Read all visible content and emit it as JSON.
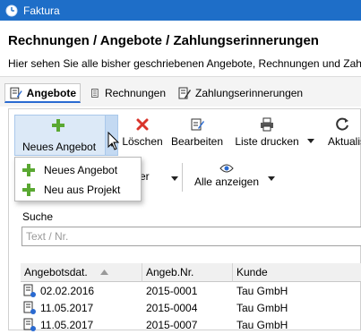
{
  "window": {
    "title": "Faktura",
    "accent": "#1e6ec8"
  },
  "header": {
    "title": "Rechnungen / Angebote / Zahlungserinnerungen",
    "subtitle": "Hier sehen Sie alle bisher geschriebenen Angebote, Rechnungen und Zahlu"
  },
  "tabs": [
    {
      "label": "Angebote",
      "icon": "document-edit-icon",
      "active": true
    },
    {
      "label": "Rechnungen",
      "icon": "document-icon",
      "active": false
    },
    {
      "label": "Zahlungserinnerungen",
      "icon": "document-reminder-icon",
      "active": false
    }
  ],
  "toolbar": {
    "new_label": "Neues Angebot",
    "delete_label": "Löschen",
    "edit_label": "Bearbeiten",
    "print_label": "Liste drucken",
    "refresh_label": "Aktualisi",
    "filter_label": "lter",
    "show_all_label": "Alle anzeigen"
  },
  "new_menu": {
    "items": [
      {
        "label": "Neues Angebot",
        "icon": "plus-icon"
      },
      {
        "label": "Neu aus Projekt",
        "icon": "plus-icon"
      }
    ]
  },
  "search": {
    "label": "Suche",
    "placeholder": "Text / Nr."
  },
  "table": {
    "columns": [
      "Angebotsdat.",
      "Angeb.Nr.",
      "Kunde"
    ],
    "sort_column": "Angebotsdat.",
    "sort_direction": "ascending",
    "rows": [
      {
        "date": "02.02.2016",
        "number": "2015-0001",
        "customer": "Tau GmbH"
      },
      {
        "date": "11.05.2017",
        "number": "2015-0004",
        "customer": "Tau GmbH"
      },
      {
        "date": "11.05.2017",
        "number": "2015-0007",
        "customer": "Tau GmbH"
      }
    ]
  }
}
